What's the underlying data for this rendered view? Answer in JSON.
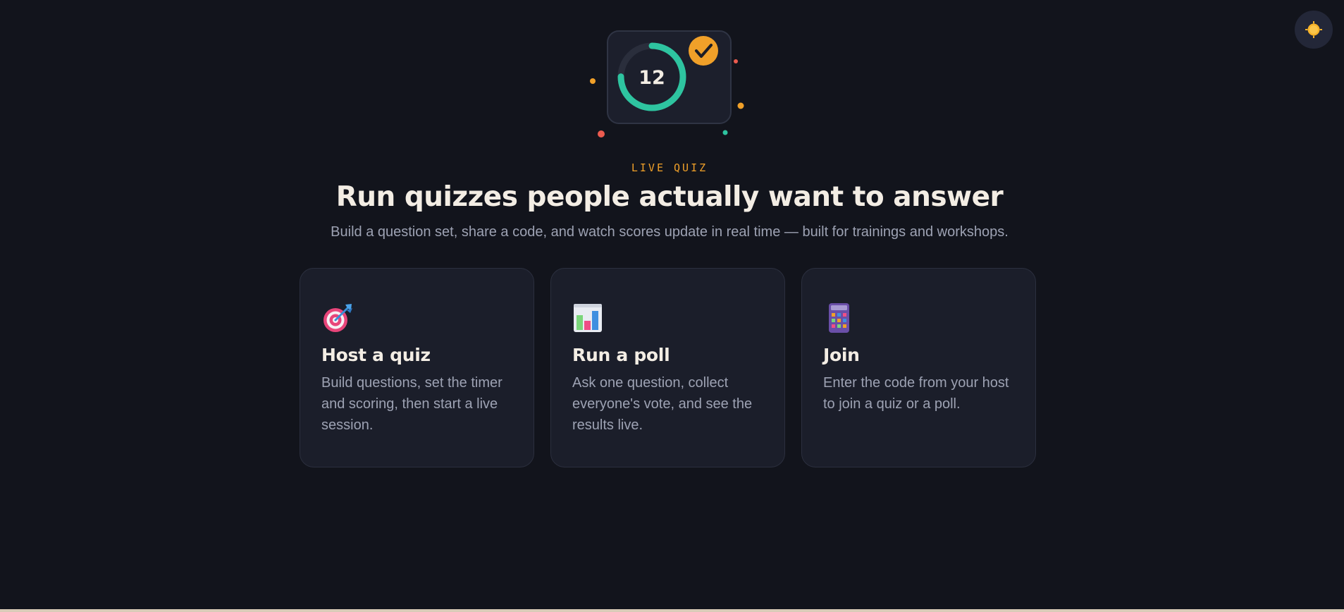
{
  "hero": {
    "timer_value": "12",
    "timer_progress": 0.75,
    "icon": "quiz-timer-icon"
  },
  "theme_toggle": {
    "icon": "sun-icon"
  },
  "eyebrow": "LIVE QUIZ",
  "title": "Run quizzes people actually want to answer",
  "subtitle": "Build a question set, share a code, and watch scores update in real time — built for trainings and workshops.",
  "cards": [
    {
      "icon": "target-icon",
      "title": "Host a quiz",
      "description": "Build questions, set the timer and scoring, then start a live session."
    },
    {
      "icon": "bar-chart-icon",
      "title": "Run a poll",
      "description": "Ask one question, collect everyone's vote, and see the results live."
    },
    {
      "icon": "keypad-icon",
      "title": "Join",
      "description": "Enter the code from your host to join a quiz or a poll."
    }
  ],
  "colors": {
    "background": "#12141c",
    "accent_orange": "#f0a029",
    "accent_teal": "#2ec4a0",
    "accent_red": "#ec5b4f",
    "card_bg": "#1b1e2a"
  }
}
